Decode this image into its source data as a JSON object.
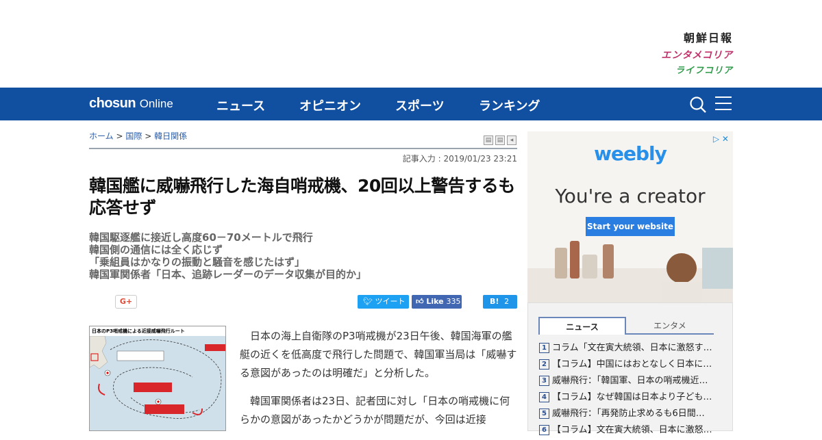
{
  "header": {
    "logo_main": "朝鮮日報",
    "logo_entame": "エンタメコリア",
    "logo_life": "ライフコリア"
  },
  "nav": {
    "brand_bold": "chosun",
    "brand_light": "Online",
    "items": [
      "ニュース",
      "オピニオン",
      "スポーツ",
      "ランキング"
    ]
  },
  "breadcrumb": {
    "home": "ホーム",
    "sep": ">",
    "cat": "国際",
    "sub": "韓日関係"
  },
  "article": {
    "date": "記事入力 : 2019/01/23 23:21",
    "headline": "韓国艦に威嚇飛行した海自哨戒機、20回以上警告するも応答せず",
    "subheads": [
      "韓国駆逐艦に接近し高度60－70メートルで飛行",
      "韓国側の通信には全く応じず",
      "「乗組員はかなりの振動と騒音を感じたはず」",
      "韓国軍関係者「日本、追跡レーダーのデータ収集が目的か」"
    ],
    "paragraphs": [
      "日本の海上自衛隊のP3哨戒機が23日午後、韓国海軍の艦艇の近くを低高度で飛行した問題で、韓国軍当局は「威嚇する意図があったのは明確だ」と分析した。",
      "韓国軍関係者は23日、記者団に対し「日本の哨戒機に何らかの意図があったかどうかが問題だが、今回は近接"
    ],
    "figure_title": "日本のP3哨戒機による近接威嚇飛行ルート"
  },
  "share": {
    "gplus": "G+",
    "tweet": "ツイート",
    "like": "Like",
    "like_count": "335",
    "hatena": "B!",
    "hatena_count": "2"
  },
  "ad": {
    "logo": "weebly",
    "tagline": "You're a creator",
    "button": "Start your website"
  },
  "ranking": {
    "tabs": [
      "ニュース",
      "エンタメ"
    ],
    "items": [
      "コラム「文在寅大統領、日本に激怒す…",
      "【コラム】中国にはおとなしく日本に…",
      "威嚇飛行：「韓国軍、日本の哨戒機近…",
      "【コラム】なぜ韓国は日本より子ども…",
      "威嚇飛行：「再発防止求めるも6日間…",
      "【コラム】文在寅大統領、日本に激怒…"
    ]
  }
}
